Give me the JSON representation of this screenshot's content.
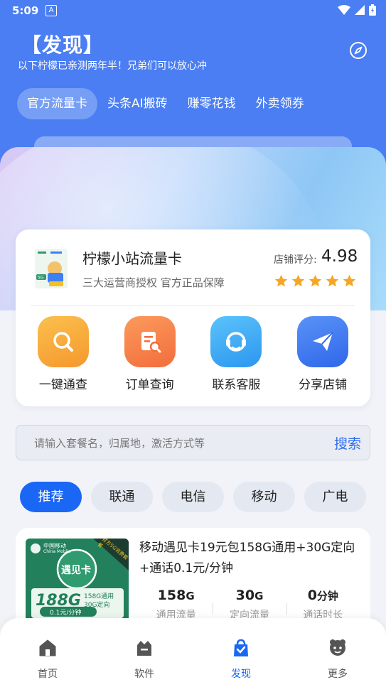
{
  "status": {
    "time": "5:09",
    "a_icon": "A"
  },
  "header": {
    "title": "【发现】",
    "subtitle": "以下柠檬已亲测两年半！兄弟们可以放心冲",
    "compass_icon": "compass-icon"
  },
  "tabs": [
    {
      "label": "官方流量卡",
      "active": true
    },
    {
      "label": "头条AI搬砖",
      "active": false
    },
    {
      "label": "赚零花钱",
      "active": false
    },
    {
      "label": "外卖领券",
      "active": false
    }
  ],
  "shop": {
    "name": "柠檬小站流量卡",
    "desc": "三大运营商授权 官方正品保障",
    "rating_label": "店铺评分:",
    "rating_value": "4.98",
    "stars": 5,
    "star_color": "#f5a623",
    "actions": [
      {
        "label": "一键通查",
        "icon": "search-icon",
        "color": "#f7a83a"
      },
      {
        "label": "订单查询",
        "icon": "order-search-icon",
        "color": "#f7814a"
      },
      {
        "label": "联系客服",
        "icon": "customer-service-icon",
        "color": "#3fa9f5"
      },
      {
        "label": "分享店铺",
        "icon": "paper-plane-icon",
        "color": "#3e7ff2"
      }
    ]
  },
  "search": {
    "placeholder": "请输入套餐名，归属地，激活方式等",
    "button": "搜索"
  },
  "filters": [
    {
      "label": "推荐",
      "active": true
    },
    {
      "label": "联通",
      "active": false
    },
    {
      "label": "电信",
      "active": false
    },
    {
      "label": "移动",
      "active": false
    },
    {
      "label": "广电",
      "active": false
    }
  ],
  "product": {
    "title": "移动遇见卡19元包158G通用+30G定向+通话0.1元/分钟",
    "image": {
      "brand": "中国移动",
      "brand_en": "China Mobile",
      "badge": "遇见卡",
      "ribbon": "官方5G资费套餐",
      "big_text": "188G",
      "line1": "158G通用",
      "line2": "30G定向",
      "price_line": "0.1元/分钟"
    },
    "stats": [
      {
        "value": "158",
        "unit": "G",
        "label": "通用流量"
      },
      {
        "value": "30",
        "unit": "G",
        "label": "定向流量"
      },
      {
        "value": "0",
        "unit": "分钟",
        "label": "通话时长"
      }
    ]
  },
  "nav": [
    {
      "label": "首页",
      "icon": "home-icon",
      "active": false
    },
    {
      "label": "软件",
      "icon": "software-icon",
      "active": false
    },
    {
      "label": "发现",
      "icon": "discover-bag-icon",
      "active": true
    },
    {
      "label": "更多",
      "icon": "more-icon",
      "active": false
    }
  ],
  "colors": {
    "primary": "#1a66f5",
    "header_bg": "#4a7ef2"
  }
}
